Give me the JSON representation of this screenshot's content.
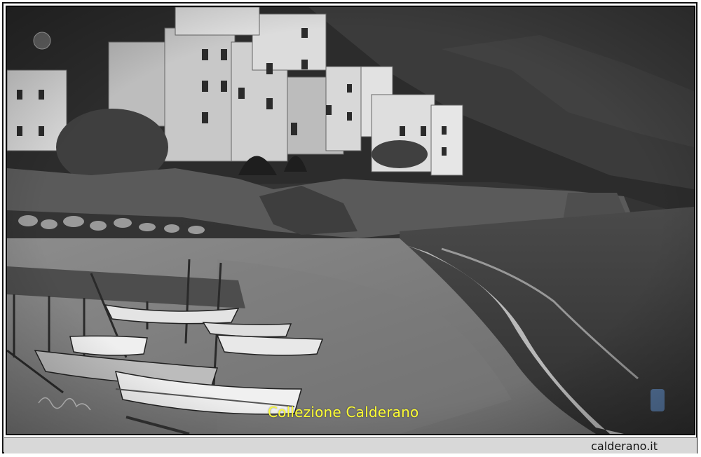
{
  "photo": {
    "description_icon": "vintage-seaside-photo-icon",
    "watermark_text": "Collezione Calderano",
    "watermark_color": "#ffff33"
  },
  "footer": {
    "site": "calderano.it"
  }
}
